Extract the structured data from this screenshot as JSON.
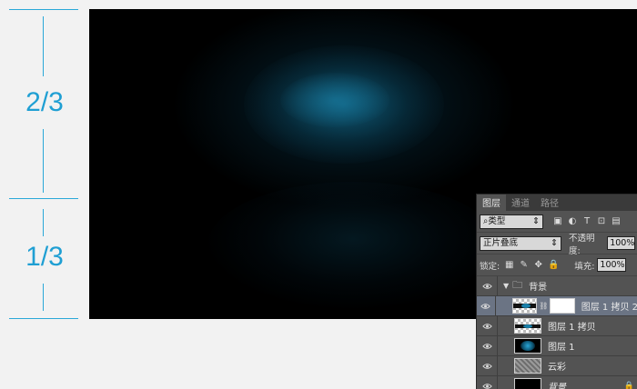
{
  "guide": {
    "top_ratio": "2/3",
    "bottom_ratio": "1/3",
    "accent": "#1f9fd3"
  },
  "canvas": {
    "glow_color": "#0e5a78"
  },
  "panel": {
    "tabs": [
      "图层",
      "通道",
      "路径"
    ],
    "filter": {
      "kind_label": "类型"
    },
    "blend": {
      "mode": "正片叠底",
      "opacity_label": "不透明度:",
      "opacity": "100%"
    },
    "lock": {
      "label": "锁定:",
      "fill_label": "填充:",
      "fill": "100%"
    },
    "group": {
      "name": "背景"
    },
    "layers": [
      {
        "name": "图层 1 拷贝 2",
        "selected": true
      },
      {
        "name": "图层 1 拷贝",
        "selected": false
      },
      {
        "name": "图层 1",
        "selected": false
      },
      {
        "name": "云彩",
        "selected": false
      },
      {
        "name": "背景",
        "selected": false
      }
    ]
  }
}
